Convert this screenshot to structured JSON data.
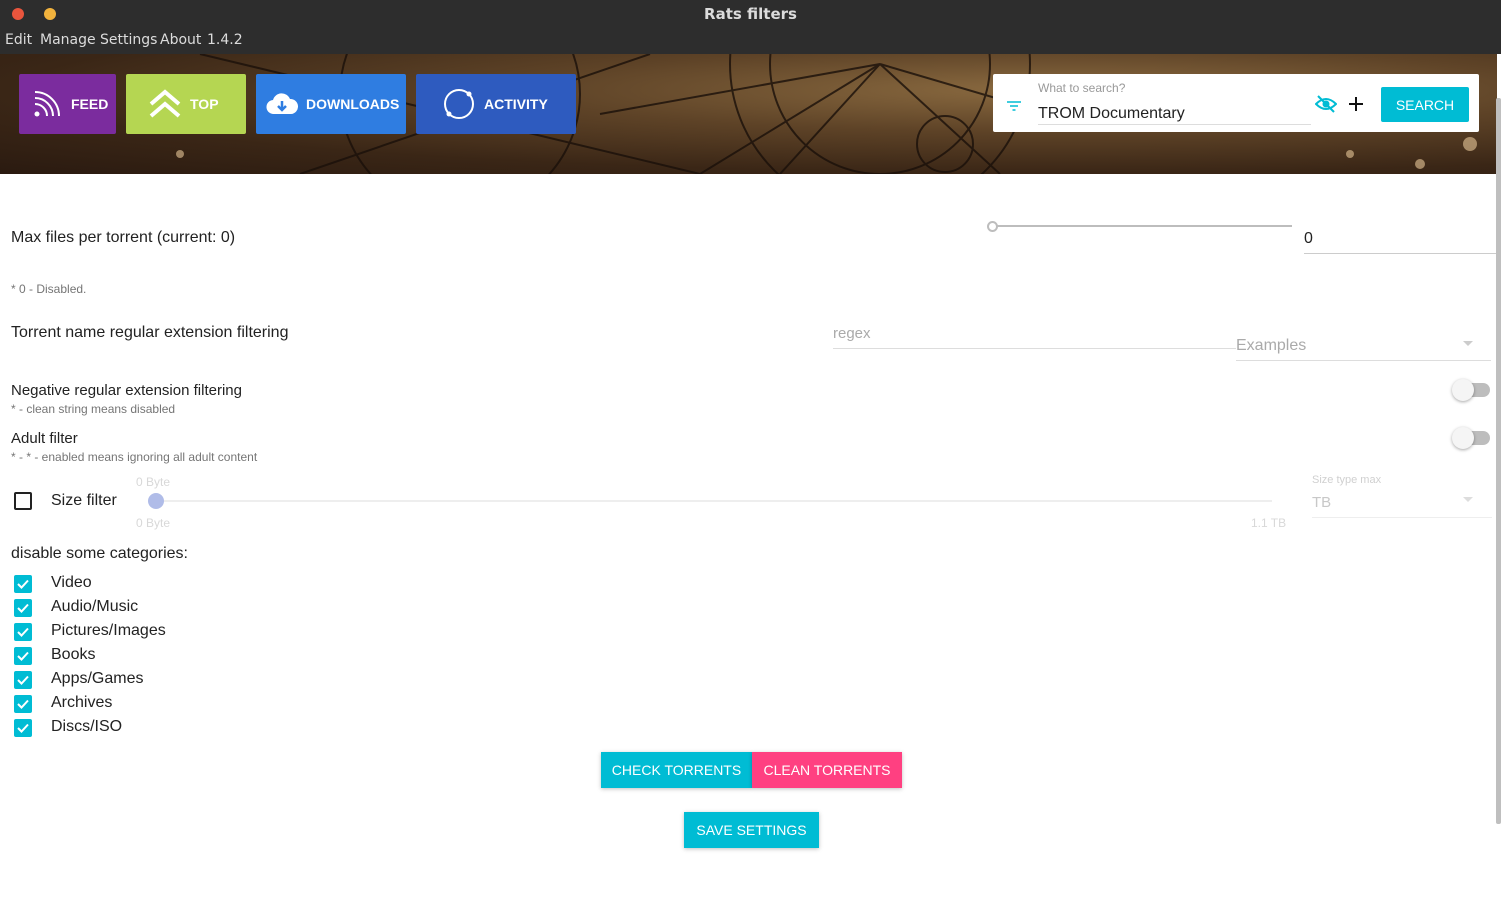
{
  "window": {
    "title": "Rats filters"
  },
  "menu": [
    "Edit",
    "Manage",
    "Settings",
    "About",
    "1.4.2"
  ],
  "nav": {
    "feed": "FEED",
    "top": "TOP",
    "downloads": "DOWNLOADS",
    "activity": "ACTIVITY"
  },
  "search": {
    "label": "What to search?",
    "value": "TROM Documentary",
    "button": "SEARCH"
  },
  "max_files": {
    "label": "Max files per torrent (current: 0)",
    "value": "0",
    "note": "* 0 - Disabled.",
    "slider_fraction": 0
  },
  "regex": {
    "label": "Torrent name regular extension filtering",
    "placeholder": "regex",
    "examples": "Examples"
  },
  "negative": {
    "label": "Negative regular extension filtering",
    "note": "* - clean string means disabled",
    "enabled": false
  },
  "adult": {
    "label": "Adult filter",
    "note": "* - * - enabled means ignoring all adult content",
    "enabled": false
  },
  "size": {
    "label": "Size filter",
    "enabled": false,
    "min_top": "0 Byte",
    "min_bottom": "0 Byte",
    "max_bottom": "1.1 TB",
    "type_label": "Size type max",
    "type_value": "TB"
  },
  "categories": {
    "heading": "disable some categories:",
    "items": [
      "Video",
      "Audio/Music",
      "Pictures/Images",
      "Books",
      "Apps/Games",
      "Archives",
      "Discs/ISO"
    ]
  },
  "actions": {
    "check": "CHECK TORRENTS",
    "clean": "CLEAN TORRENTS",
    "save": "SAVE SETTINGS"
  },
  "colors": {
    "feed": "#7b2c9e",
    "top": "#b5d652",
    "downloads": "#2f7de1",
    "activity": "#2e5bbf",
    "accent": "#00bcd4",
    "danger": "#ff4081"
  }
}
